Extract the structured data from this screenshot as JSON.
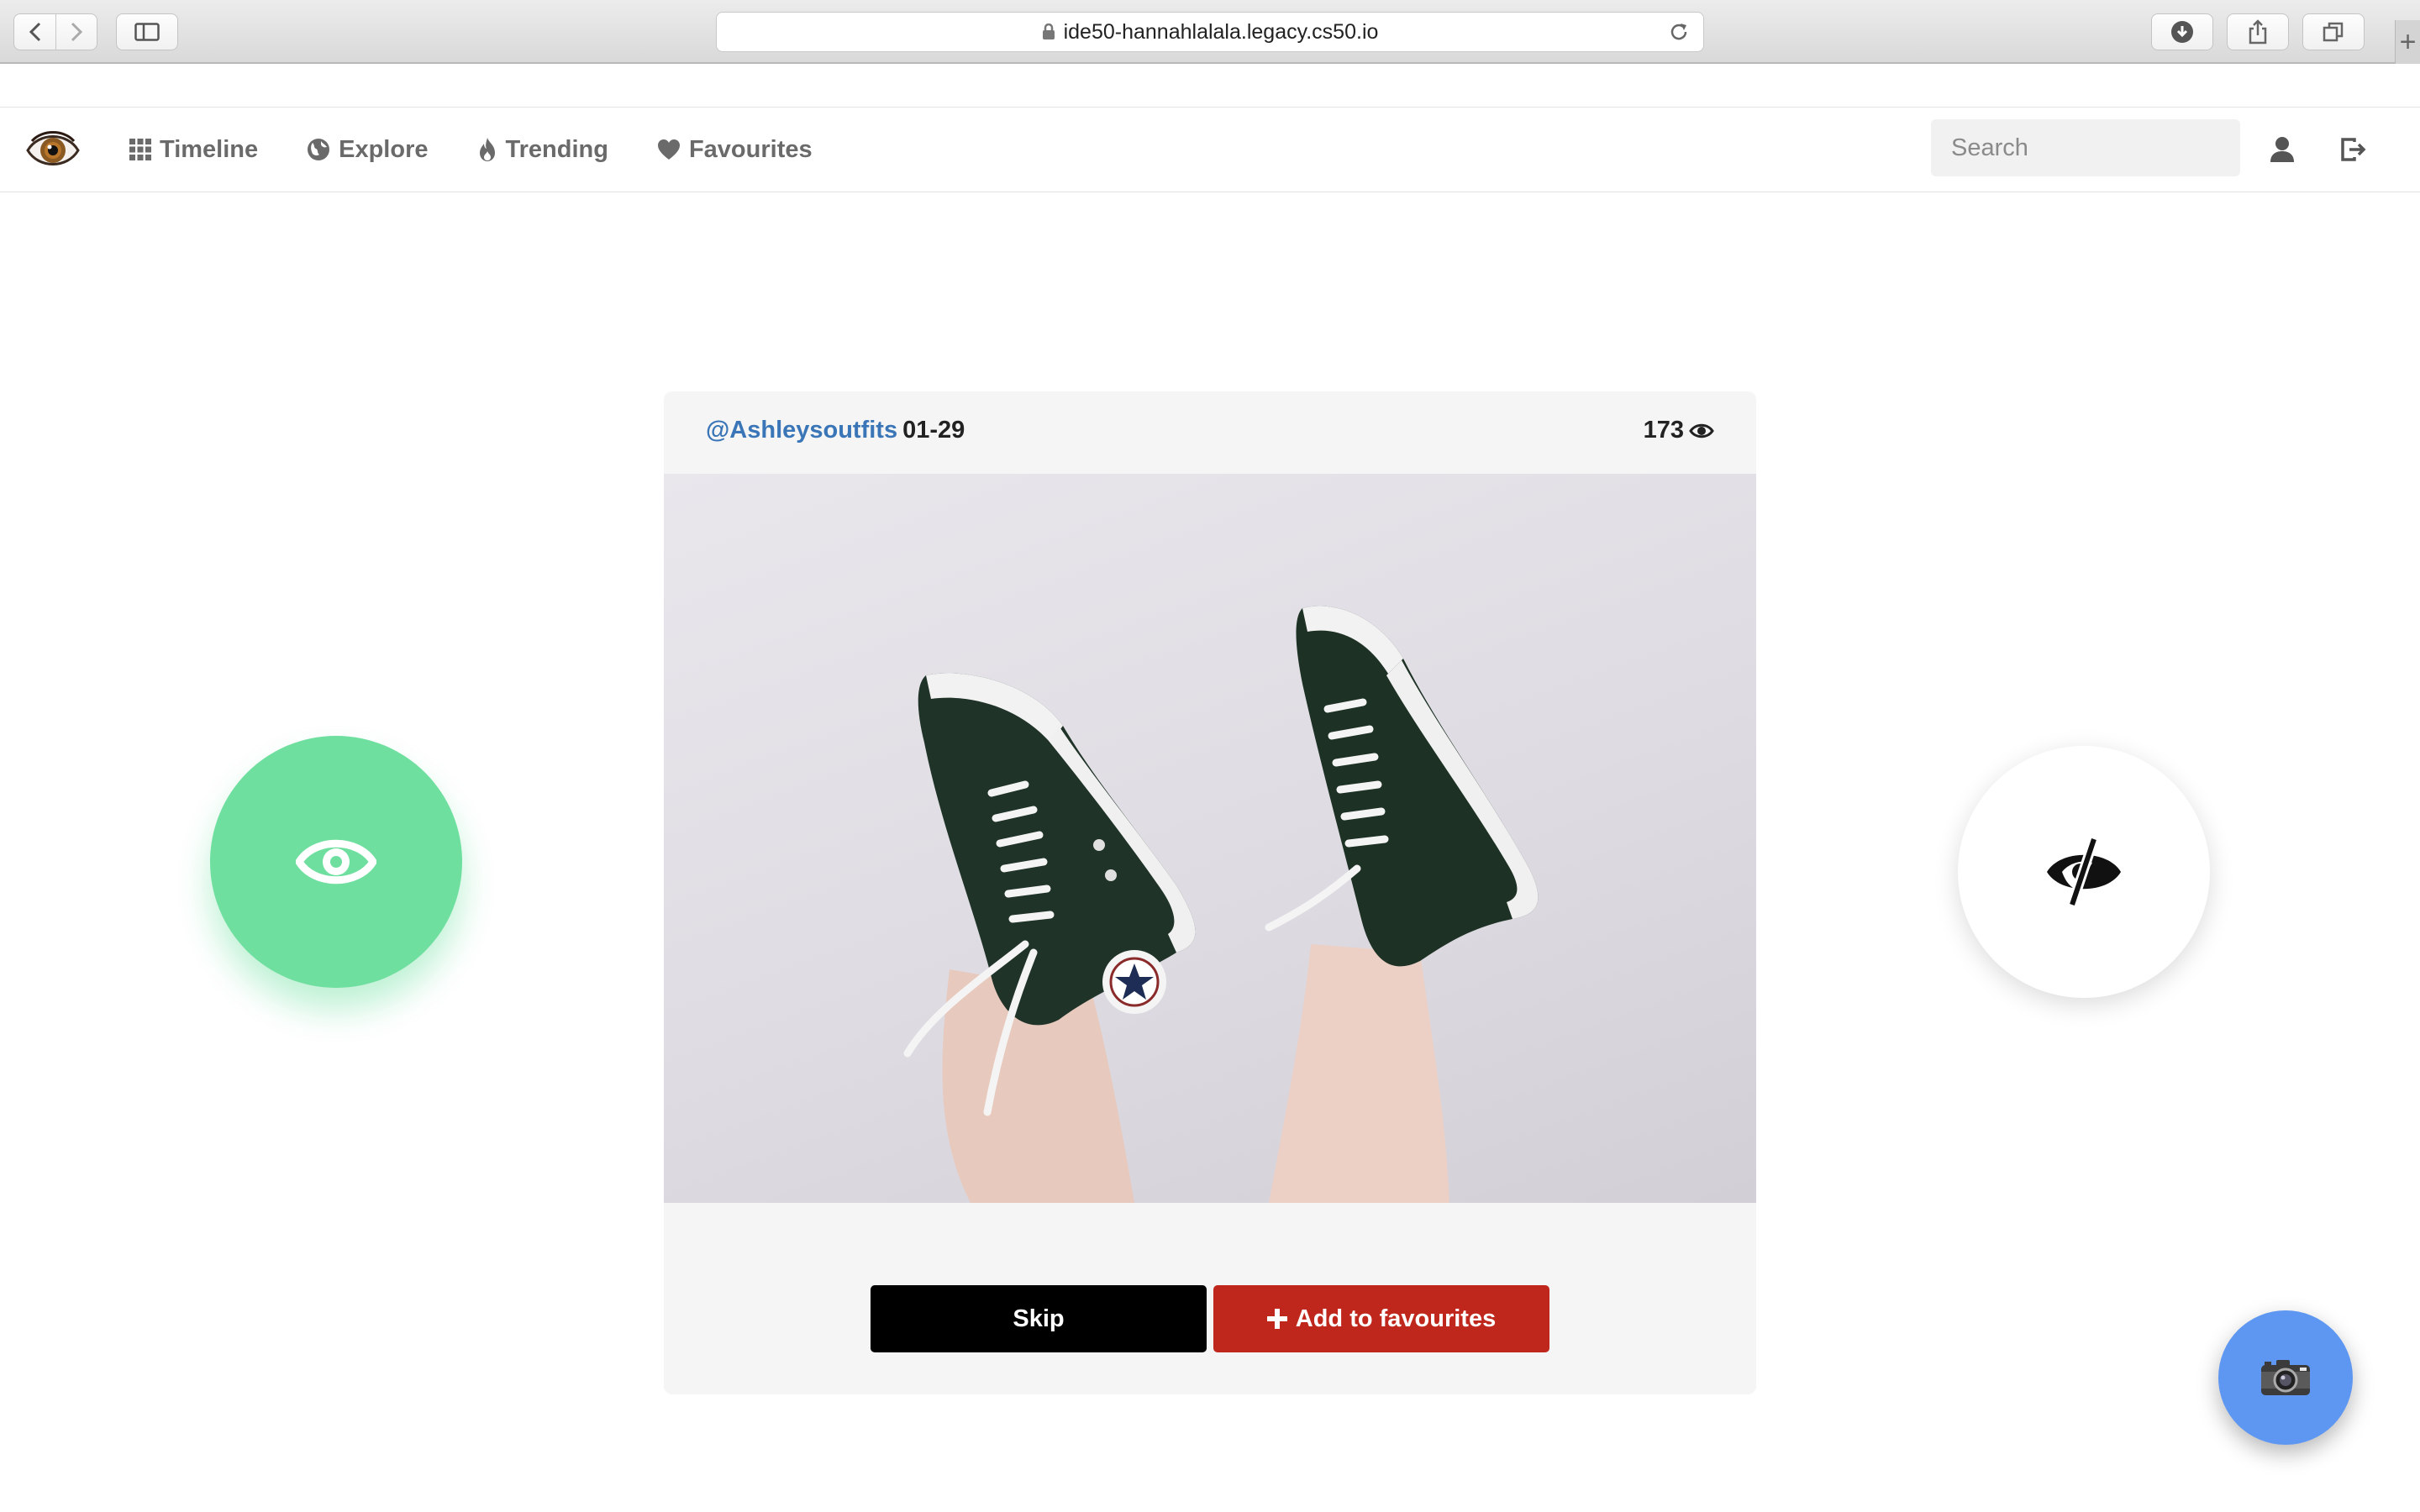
{
  "browser": {
    "url": "ide50-hannahlalala.legacy.cs50.io"
  },
  "navbar": {
    "links": [
      {
        "label": "Timeline",
        "icon": "grid-icon"
      },
      {
        "label": "Explore",
        "icon": "globe-icon"
      },
      {
        "label": "Trending",
        "icon": "fire-icon"
      },
      {
        "label": "Favourites",
        "icon": "heart-icon"
      }
    ],
    "search_placeholder": "Search"
  },
  "post": {
    "author": "@Ashleysoutfits",
    "date": "01-29",
    "views": "173",
    "image_alt": "Two legs wearing black high-top sneakers against a white wall"
  },
  "actions": {
    "skip_label": "Skip",
    "favourite_label": "Add to favourites"
  },
  "colors": {
    "see_circle": "#6fdf9f",
    "author_link": "#3a76b7",
    "favourite_button": "#c0271c",
    "camera_fab": "#5d97f2"
  }
}
